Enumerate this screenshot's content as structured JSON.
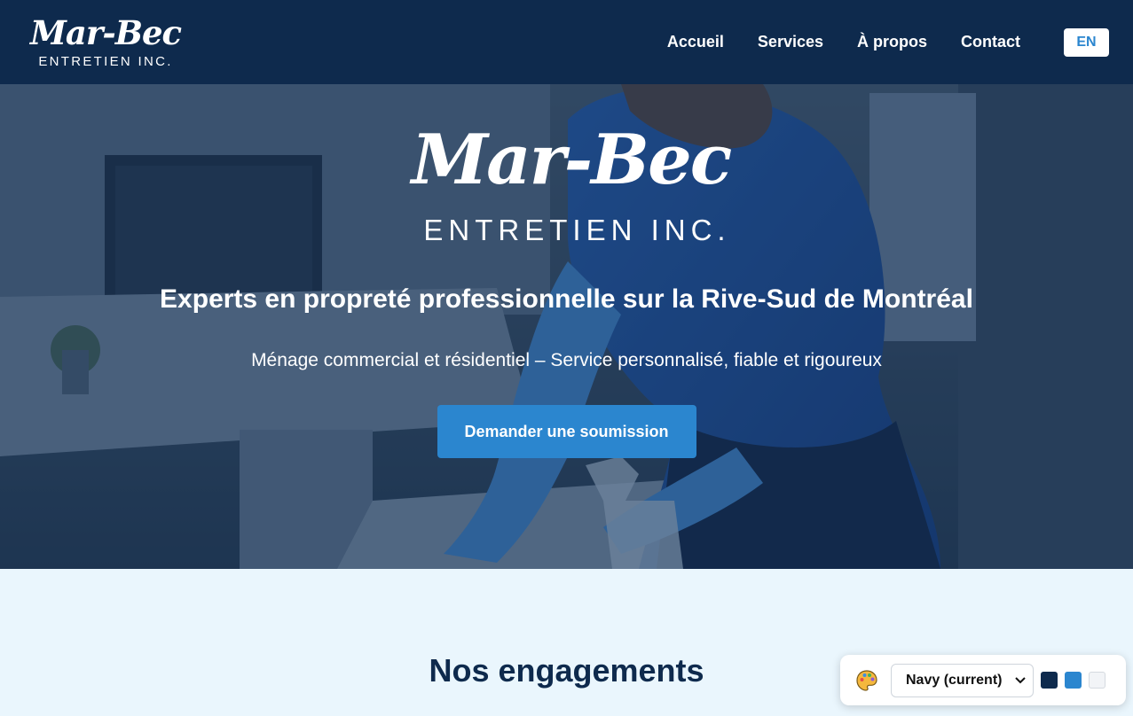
{
  "header": {
    "brand_script": "Mar-Bec",
    "brand_sub": "ENTRETIEN INC.",
    "nav": [
      "Accueil",
      "Services",
      "À propos",
      "Contact"
    ],
    "lang_toggle": "EN",
    "colors": {
      "background": "#0e2a4d",
      "text": "#ffffff",
      "accent": "#2b86cf"
    }
  },
  "hero": {
    "brand_script": "Mar-Bec",
    "brand_sub": "ENTRETIEN INC.",
    "headline": "Experts en propreté professionnelle sur la Rive-Sud de Montréal",
    "tagline": "Ménage commercial et résidentiel – Service personnalisé, fiable et rigoureux",
    "cta_label": "Demander une soumission",
    "background_image": "cleaner-wiping-office-desk-photo"
  },
  "section": {
    "title": "Nos engagements"
  },
  "theme_switcher": {
    "icon": "palette-icon",
    "selected": "Navy (current)",
    "swatches": [
      "#0e2a4d",
      "#2b86cf",
      "#f2f4f7"
    ]
  }
}
